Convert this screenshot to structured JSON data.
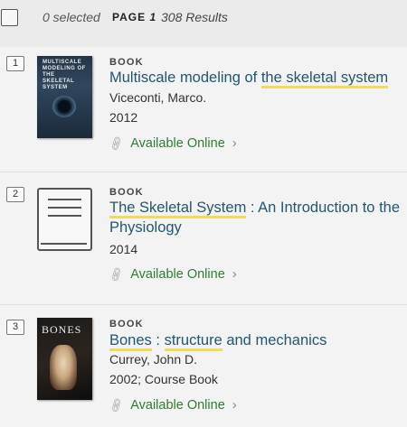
{
  "toolbar": {
    "selected_text": "0 selected",
    "page_label": "PAGE",
    "page_number": "1",
    "results_text": "308 Results"
  },
  "results": [
    {
      "index": "1",
      "type": "BOOK",
      "title_pre": "Multiscale modeling of ",
      "title_hl": "the skeletal system",
      "title_post": "",
      "author": "Viceconti, Marco.",
      "date": "2012",
      "availability": "Available Online",
      "cover_text": "MULTISCALE MODELING OF THE SKELETAL SYSTEM"
    },
    {
      "index": "2",
      "type": "BOOK",
      "title_pre": "",
      "title_hl": "The Skeletal System",
      "title_post": " : An Introduction to the",
      "title_line2": "Physiology",
      "author": "",
      "date": "2014",
      "availability": "Available Online"
    },
    {
      "index": "3",
      "type": "BOOK",
      "title_hl1": "Bones",
      "title_mid": " : ",
      "title_hl2": "structure",
      "title_post": " and mechanics",
      "author": "Currey, John D.",
      "date": "2002; Course Book",
      "availability": "Available Online",
      "cover_text": "BONES"
    }
  ],
  "colors": {
    "title_link": "#24566e",
    "highlight": "#f4d95a",
    "available": "#2e7d32"
  }
}
